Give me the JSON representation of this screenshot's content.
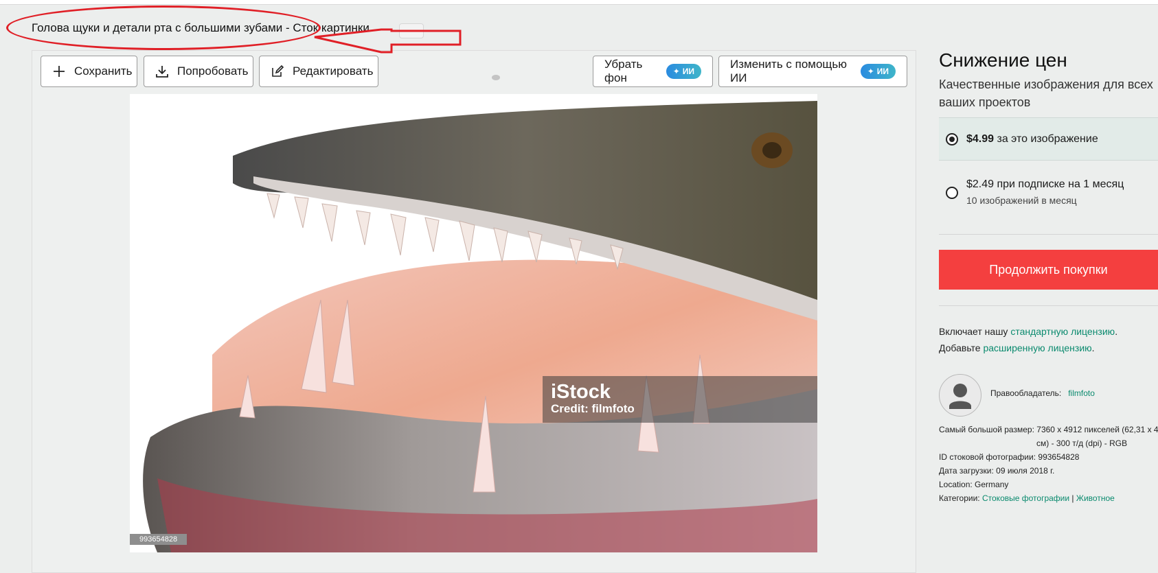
{
  "page": {
    "title": "Голова щуки и детали рта с большими зубами - Сток картинки"
  },
  "toolbar": {
    "save_label": "Сохранить",
    "try_label": "Попробовать",
    "edit_label": "Редактировать",
    "remove_bg_label": "Убрать фон",
    "ai_edit_label": "Изменить с помощью ИИ",
    "ai_badge": "ИИ"
  },
  "image": {
    "watermark_logo": "iStock",
    "watermark_credit": "Credit: filmfoto",
    "id_tag": "993654828"
  },
  "sidebar": {
    "title": "Снижение цен",
    "subtitle": "Качественные изображения для всех ваших проектов",
    "option1": {
      "price": "$4.99",
      "text": "за это изображение",
      "selected": true
    },
    "option2": {
      "text": "$2.49 при подписке на 1 месяц",
      "sub": "10 изображений в месяц",
      "selected": false
    },
    "buy_button": "Продолжить покупки",
    "license_line1_prefix": "Включает нашу",
    "license_line1_link": "стандартную лицензию",
    "license_line2_prefix": "Добавьте",
    "license_line2_link": "расширенную лицензию",
    "owner_label": "Правообладатель:",
    "owner_value": "filmfoto",
    "meta": {
      "size_label": "Самый большой размер:",
      "size_value": "7360 x 4912 пикселей (62,31 x 4",
      "size_value2": "см) - 300 т/д (dpi) - RGB",
      "id_label": "ID стоковой фотографии:",
      "id_value": "993654828",
      "date_label": "Дата загрузки:",
      "date_value": "09 июля 2018 г.",
      "location_label": "Location:",
      "location_value": "Germany",
      "categories_label": "Категории:",
      "category1": "Стоковые фотографии",
      "category_sep": "|",
      "category2": "Животное"
    }
  },
  "colors": {
    "accent_red": "#f43f3f",
    "link_green": "#0a8a6e",
    "annotation_red": "#e01f26",
    "ai_blue": "#2a8be0"
  }
}
